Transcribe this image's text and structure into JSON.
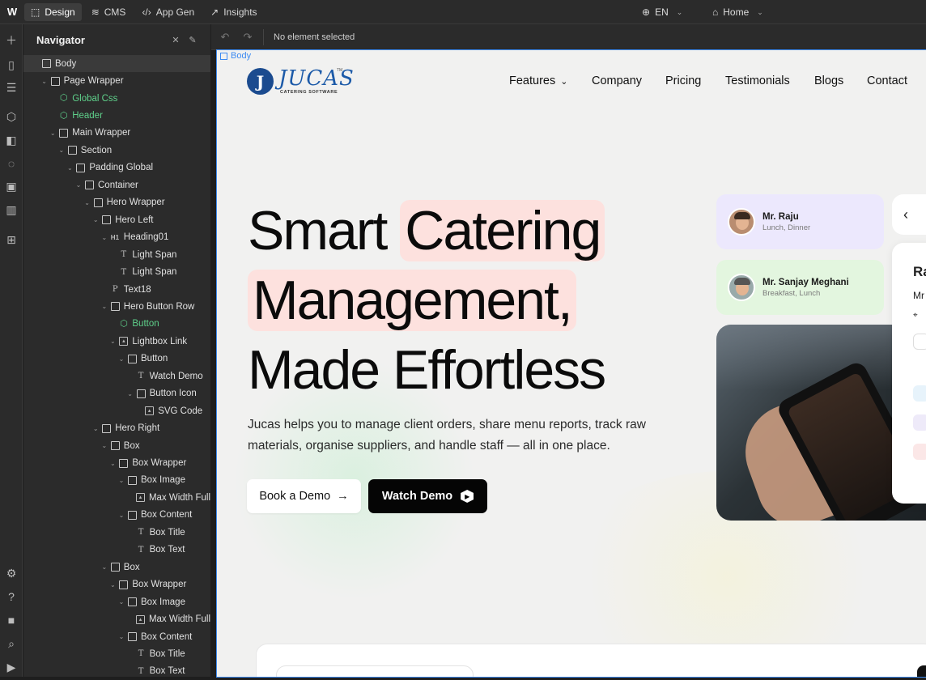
{
  "topbar": {
    "logo": "W",
    "tabs": [
      {
        "label": "Design",
        "icon": "design-icon"
      },
      {
        "label": "CMS",
        "icon": "database-icon"
      },
      {
        "label": "App Gen",
        "icon": "code-icon"
      },
      {
        "label": "Insights",
        "icon": "chart-icon"
      }
    ],
    "locale": "EN",
    "page": "Home"
  },
  "navigator": {
    "title": "Navigator",
    "tree": [
      {
        "label": "Body",
        "indent": 0,
        "type": "box",
        "caret": false
      },
      {
        "label": "Page Wrapper",
        "indent": 1,
        "type": "box",
        "caret": true
      },
      {
        "label": "Global Css",
        "indent": 2,
        "type": "comp",
        "caret": false
      },
      {
        "label": "Header",
        "indent": 2,
        "type": "comp",
        "caret": false
      },
      {
        "label": "Main Wrapper",
        "indent": 2,
        "type": "box",
        "caret": true
      },
      {
        "label": "Section",
        "indent": 3,
        "type": "box",
        "caret": true
      },
      {
        "label": "Padding Global",
        "indent": 4,
        "type": "box",
        "caret": true
      },
      {
        "label": "Container",
        "indent": 5,
        "type": "box",
        "caret": true
      },
      {
        "label": "Hero Wrapper",
        "indent": 6,
        "type": "box",
        "caret": true
      },
      {
        "label": "Hero Left",
        "indent": 7,
        "type": "box",
        "caret": true
      },
      {
        "label": "Heading01",
        "indent": 8,
        "type": "h1",
        "caret": true
      },
      {
        "label": "Light Span",
        "indent": 9,
        "type": "txt",
        "caret": false
      },
      {
        "label": "Light Span",
        "indent": 9,
        "type": "txt",
        "caret": false
      },
      {
        "label": "Text18",
        "indent": 8,
        "type": "p",
        "caret": false
      },
      {
        "label": "Hero Button Row",
        "indent": 8,
        "type": "box",
        "caret": true
      },
      {
        "label": "Button",
        "indent": 9,
        "type": "comp",
        "caret": false
      },
      {
        "label": "Lightbox Link",
        "indent": 9,
        "type": "img",
        "caret": true
      },
      {
        "label": "Button",
        "indent": 10,
        "type": "box",
        "caret": true
      },
      {
        "label": "Watch Demo",
        "indent": 11,
        "type": "txt",
        "caret": false
      },
      {
        "label": "Button Icon",
        "indent": 11,
        "type": "box",
        "caret": true
      },
      {
        "label": "SVG Code",
        "indent": 12,
        "type": "img",
        "caret": false
      },
      {
        "label": "Hero Right",
        "indent": 7,
        "type": "box",
        "caret": true
      },
      {
        "label": "Box",
        "indent": 8,
        "type": "box",
        "caret": true
      },
      {
        "label": "Box Wrapper",
        "indent": 9,
        "type": "box",
        "caret": true
      },
      {
        "label": "Box Image",
        "indent": 10,
        "type": "box",
        "caret": true
      },
      {
        "label": "Max Width Full",
        "indent": 11,
        "type": "img",
        "caret": false
      },
      {
        "label": "Box Content",
        "indent": 10,
        "type": "box",
        "caret": true
      },
      {
        "label": "Box Title",
        "indent": 11,
        "type": "txt",
        "caret": false
      },
      {
        "label": "Box Text",
        "indent": 11,
        "type": "txt",
        "caret": false
      },
      {
        "label": "Box",
        "indent": 8,
        "type": "box",
        "caret": true
      },
      {
        "label": "Box Wrapper",
        "indent": 9,
        "type": "box",
        "caret": true
      },
      {
        "label": "Box Image",
        "indent": 10,
        "type": "box",
        "caret": true
      },
      {
        "label": "Max Width Full",
        "indent": 11,
        "type": "img",
        "caret": false
      },
      {
        "label": "Box Content",
        "indent": 10,
        "type": "box",
        "caret": true
      },
      {
        "label": "Box Title",
        "indent": 11,
        "type": "txt",
        "caret": false
      },
      {
        "label": "Box Text",
        "indent": 11,
        "type": "txt",
        "caret": false
      }
    ]
  },
  "canvas_toolbar": {
    "status": "No element selected"
  },
  "canvas": {
    "body_tag": "Body"
  },
  "site": {
    "logo_word": "JUCAS",
    "logo_sub": "CATERING SOFTWARE",
    "logo_tm": "TM",
    "nav": [
      "Features",
      "Company",
      "Pricing",
      "Testimonials",
      "Blogs",
      "Contact"
    ],
    "hero": {
      "line1_plain": "Smart",
      "line1_highlight": "Catering",
      "line2_highlight": "Management,",
      "line3": "Made Effortless",
      "description": "Jucas helps you to manage client orders, share menu reports, track raw materials, organise suppliers, and handle staff — all in one place.",
      "btn_demo": "Book a Demo",
      "btn_watch": "Watch Demo"
    },
    "cards": [
      {
        "name": "Mr. Raju",
        "meals": "Lunch, Dinner",
        "bg": "#ece8fd"
      },
      {
        "name": "Mr. Sanjay Meghani",
        "meals": "Breakfast, Lunch",
        "bg": "#e3f6df"
      }
    ],
    "panel_texts": {
      "title": "Ra",
      "line": "Mr"
    }
  },
  "colors": {
    "accent_highlight": "#fde1de",
    "selection_blue": "#3d8bf2",
    "component_green": "#5fd18b"
  }
}
